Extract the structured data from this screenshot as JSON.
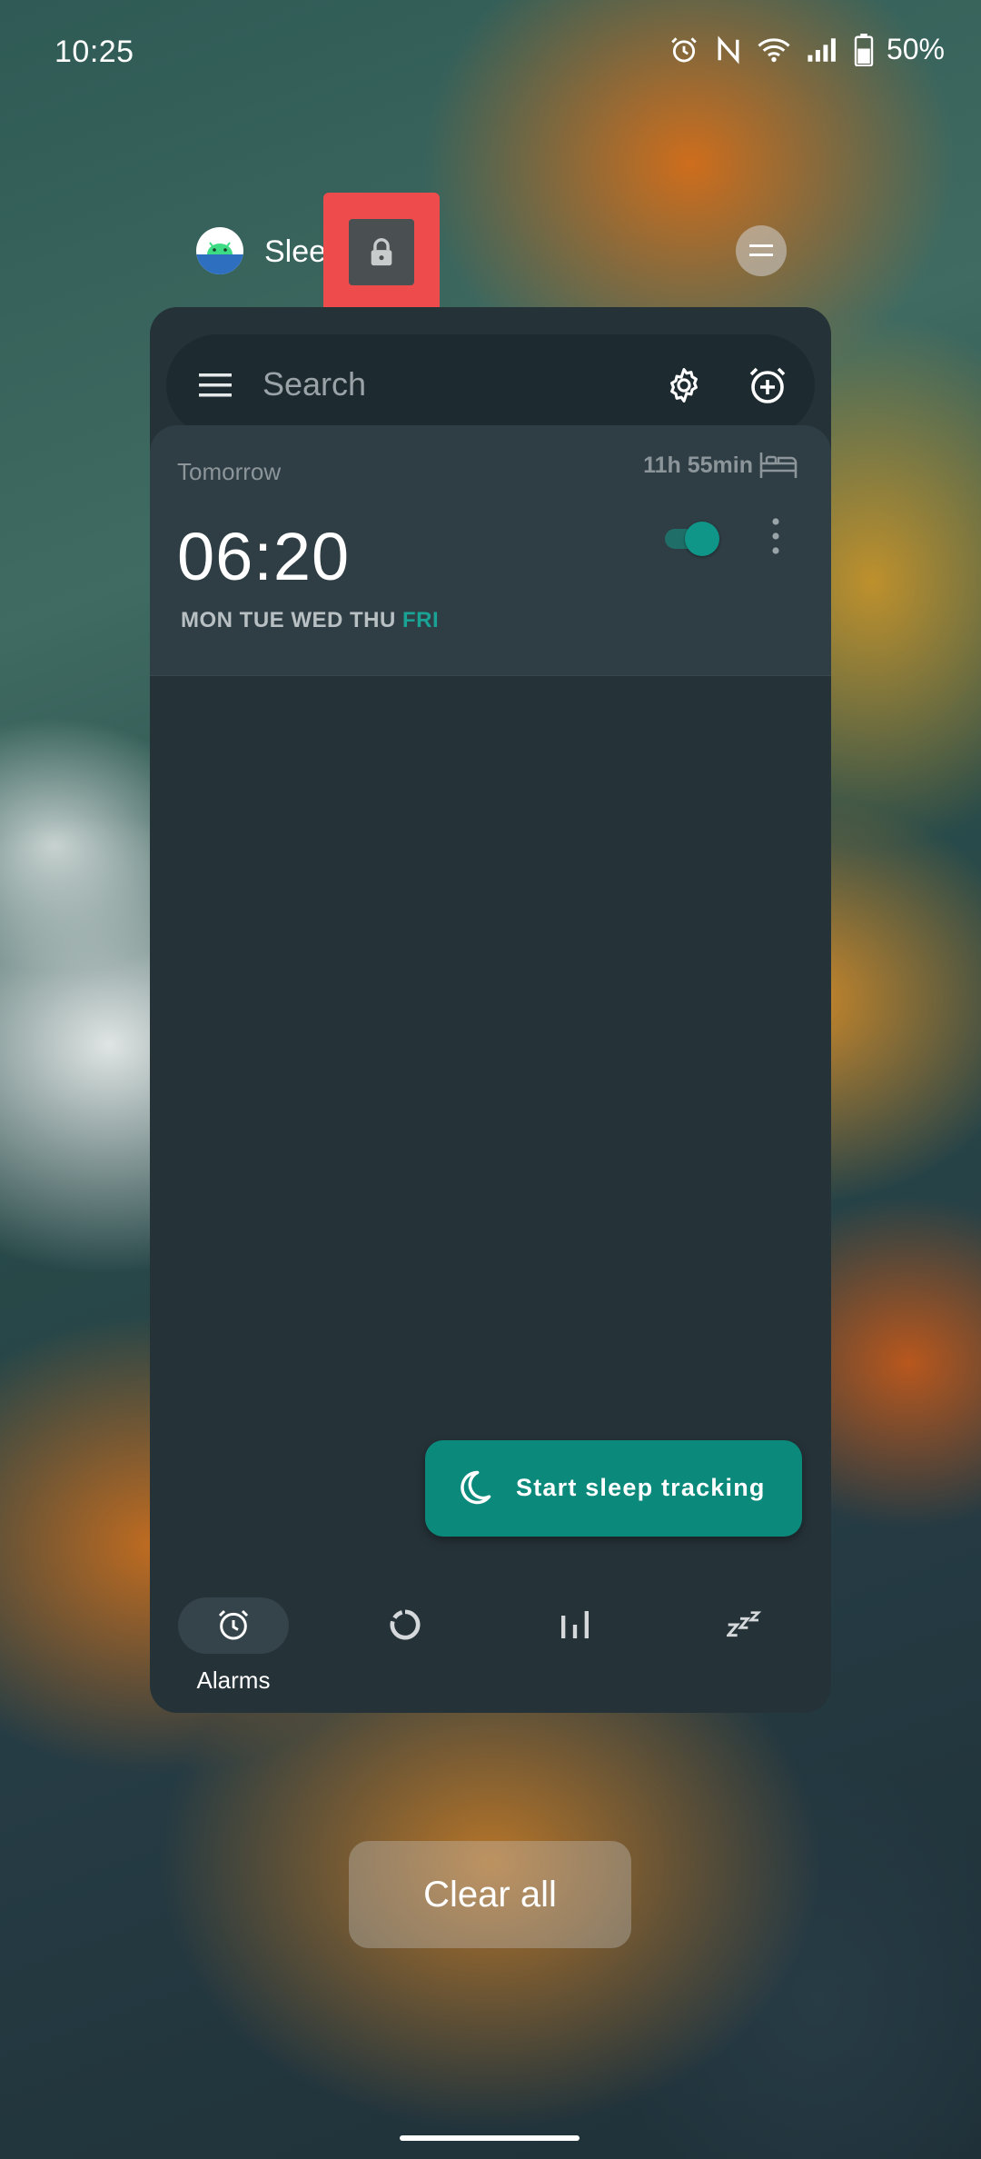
{
  "status_bar": {
    "time": "10:25",
    "battery": "50%",
    "icons": [
      "alarm-icon",
      "nfc-icon",
      "wifi-icon",
      "signal-icon",
      "battery-icon"
    ]
  },
  "recents": {
    "app_name": "Slee",
    "app_icon": "android-icon",
    "lock_icon": "lock-icon",
    "clear_all": "Clear all",
    "highlight_color": "#ee4b4d"
  },
  "app": {
    "search": {
      "placeholder": "Search"
    },
    "alarm": {
      "when": "Tomorrow",
      "remaining": "11h 55min",
      "time": "06:20",
      "days_inactive": "MON TUE WED THU",
      "days_active": "FRI",
      "enabled": true
    },
    "fab": {
      "label": "Start sleep tracking",
      "icon": "moon-icon"
    },
    "nav": [
      {
        "label": "Alarms",
        "icon": "alarm-clock-icon",
        "selected": true
      },
      {
        "label": "",
        "icon": "progress-ring-icon",
        "selected": false
      },
      {
        "label": "",
        "icon": "bar-chart-icon",
        "selected": false
      },
      {
        "label": "",
        "icon": "zzz-icon",
        "selected": false
      }
    ],
    "colors": {
      "accent": "#0b8a7c",
      "background": "#253238",
      "card": "#2f3d44"
    }
  }
}
